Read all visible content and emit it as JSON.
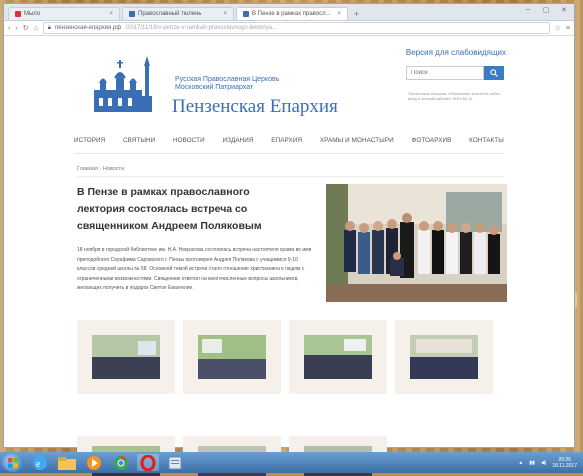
{
  "browser": {
    "tabs": [
      {
        "label": "Мыло"
      },
      {
        "label": "Православный тюлень"
      },
      {
        "label": "В Пензе в рамках правосл..."
      }
    ],
    "new_tab": "+",
    "address": "пензенская-епархия.рф",
    "address_rest": "/2017/11/18/v-penze-v-ramkah-pravoslavnogo-lektoriya..."
  },
  "site": {
    "church_line1": "Русская Православная Церковь",
    "church_line2": "Московский Патриархат",
    "title": "Пензенская Епархия",
    "vision_link": "Версия для слабовидящих",
    "search_placeholder": "Поиск",
    "header_note": "Пензенская епархия, обновление контента сайта, вход в личный кабинет, ИНН 58-12",
    "nav": [
      {
        "label": "ИСТОРИЯ"
      },
      {
        "label": "СВЯТЫНИ"
      },
      {
        "label": "НОВОСТИ"
      },
      {
        "label": "ИЗДАНИЯ"
      },
      {
        "label": "ЕПАРХИЯ"
      },
      {
        "label": "ХРАМЫ И МОНАСТЫРИ"
      },
      {
        "label": "ФОТОАРХИВ"
      },
      {
        "label": "КОНТАКТЫ"
      }
    ],
    "breadcrumb": {
      "home": "Главная",
      "sep": "›",
      "current": "Новости"
    },
    "article": {
      "title": "В Пензе в рамках православного лектория состоялась встреча со священником Андреем Поляковым",
      "body": "18 ноября в городской библиотеке им. Н.А. Некрасова состоялась встреча настоятеля храма во имя преподобного Серафима Саровского г. Пензы протоиерея Андрея Полякова с учащимися 9-10 классов средней школы № 58. Основной темой встречи стало отношение христианина к людям с ограниченными возможностями. Священник ответил на многочисленные вопросы школьников, желающих получить в подарок Святое Евангелие."
    }
  },
  "taskbar": {
    "clock_time": "20:26",
    "clock_date": "18.11.2017"
  },
  "colors": {
    "accent": "#3a6fb5",
    "search_button": "#3a7cc4",
    "taskbar_top": "#6b9fd2"
  }
}
